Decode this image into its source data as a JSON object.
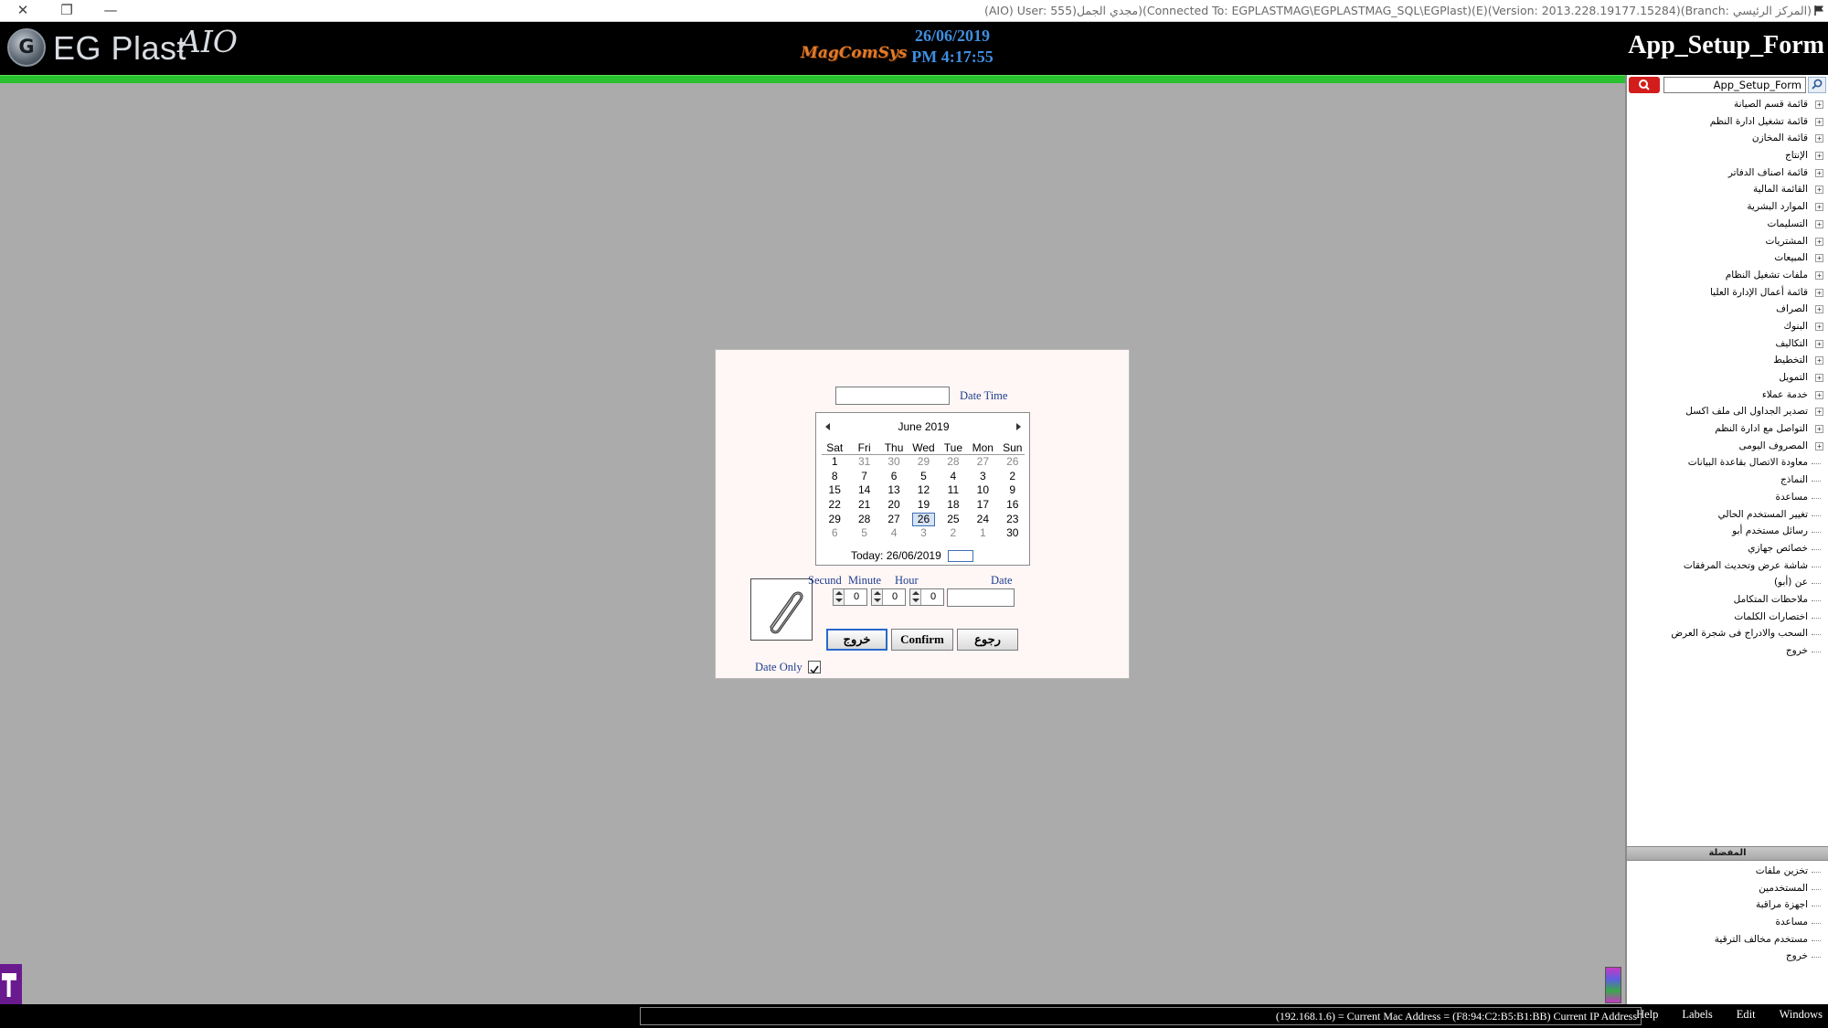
{
  "titlebar": {
    "title": "(AIO) User: 555)مجدي الجمل)(Connected To: EGPLASTMAG\\EGPLASTMAG_SQL\\EGPlast)(E)(Version: 2013.228.19177.15284)(Branch: المركز الرئيسي)",
    "close_glyph": "✕",
    "restore_glyph": "❐",
    "minimize_glyph": "—"
  },
  "header": {
    "logo_mark": "G",
    "logo_text": "EG Plast",
    "logo_script": "AIO",
    "brand": "MagComSys",
    "date": "26/06/2019",
    "time": "PM 4:17:55",
    "form_title": "App_Setup_Form"
  },
  "right_panel": {
    "search_value": "App_Setup_Form",
    "tree_items": [
      {
        "label": "قائمة قسم الصيانة",
        "expandable": true
      },
      {
        "label": "قائمة تشغيل ادارة النظم",
        "expandable": true
      },
      {
        "label": "قائمة المخازن",
        "expandable": true
      },
      {
        "label": "الإنتاج",
        "expandable": true
      },
      {
        "label": "قائمة اصناف الدفاتر",
        "expandable": true
      },
      {
        "label": "القائمة المالية",
        "expandable": true
      },
      {
        "label": "الموارد البشرية",
        "expandable": true
      },
      {
        "label": "التسليمات",
        "expandable": true
      },
      {
        "label": "المشتريات",
        "expandable": true
      },
      {
        "label": "المبيعات",
        "expandable": true
      },
      {
        "label": "ملفات تشغيل النظام",
        "expandable": true
      },
      {
        "label": "قائمة أعمال الإدارة العليا",
        "expandable": true
      },
      {
        "label": "الصراف",
        "expandable": true
      },
      {
        "label": "البنوك",
        "expandable": true
      },
      {
        "label": "التكاليف",
        "expandable": true
      },
      {
        "label": "التخطيط",
        "expandable": true
      },
      {
        "label": "التمويل",
        "expandable": true
      },
      {
        "label": "خدمة عملاء",
        "expandable": true
      },
      {
        "label": "تصدير الجداول الى ملف اكسل",
        "expandable": true
      },
      {
        "label": "التواصل مع ادارة النظم",
        "expandable": true
      },
      {
        "label": "المصروف اليومى",
        "expandable": true
      },
      {
        "label": "معاودة الاتصال بقاعدة البيانات",
        "expandable": false
      },
      {
        "label": "النماذج",
        "expandable": false
      },
      {
        "label": "مساعدة",
        "expandable": false
      },
      {
        "label": "تغيير المستخدم الحالي",
        "expandable": false
      },
      {
        "label": "رسائل مستخدم أبو",
        "expandable": false
      },
      {
        "label": "خصائص جهازي",
        "expandable": false
      },
      {
        "label": "شاشة عرض وتحديث المرفقات",
        "expandable": false
      },
      {
        "label": "عن (أبو)",
        "expandable": false
      },
      {
        "label": "ملاحظات المتكامل",
        "expandable": false
      },
      {
        "label": "اختصارات الكلمات",
        "expandable": false
      },
      {
        "label": "السحب والادراج فى شجرة العرض",
        "expandable": false
      },
      {
        "label": "خروج",
        "expandable": false
      }
    ],
    "favorites_header": "المفضلة",
    "favorites": [
      {
        "label": "تخزين ملفات"
      },
      {
        "label": "المستخدمين"
      },
      {
        "label": "اجهزة مراقبة"
      },
      {
        "label": "مساعدة"
      },
      {
        "label": "مستخدم مخالف الترقية"
      },
      {
        "label": "خروج"
      }
    ]
  },
  "dialog": {
    "datetime_label": "Date Time",
    "datetime_value": "",
    "calendar": {
      "month_label": "June 2019",
      "day_headers": [
        "Sat",
        "Fri",
        "Thu",
        "Wed",
        "Tue",
        "Mon",
        "Sun"
      ],
      "weeks": [
        [
          "1",
          "31",
          "30",
          "29",
          "28",
          "27",
          "26"
        ],
        [
          "8",
          "7",
          "6",
          "5",
          "4",
          "3",
          "2"
        ],
        [
          "15",
          "14",
          "13",
          "12",
          "11",
          "10",
          "9"
        ],
        [
          "22",
          "21",
          "20",
          "19",
          "18",
          "17",
          "16"
        ],
        [
          "29",
          "28",
          "27",
          "26",
          "25",
          "24",
          "23"
        ],
        [
          "6",
          "5",
          "4",
          "3",
          "2",
          "1",
          "30"
        ]
      ],
      "today_label": "Today: 26/06/2019",
      "selected_day": "26"
    },
    "time_labels": {
      "second": "Secund",
      "minute": "Minute",
      "hour": "Hour",
      "date": "Date"
    },
    "second_value": "0",
    "minute_value": "0",
    "hour_value": "0",
    "date_value": "",
    "buttons": {
      "exit": "خروج",
      "confirm": "Confirm",
      "back": "رجوع"
    },
    "date_only_label": "Date Only",
    "date_only_checked": true
  },
  "statusbar": {
    "ip_text": "(192.168.1.6) = Current Mac Address = (F8:94:C2:B5:B1:BB) Current IP Address",
    "menu": [
      "Windows",
      "Edit",
      "Labels",
      "Help"
    ]
  },
  "colors": {
    "header_bg": "#000000",
    "accent_green": "#29c12f",
    "date_blue": "#3f8ee0",
    "label_blue": "#1e3e8e",
    "dialog_bg": "#fff6f6",
    "workspace_gray": "#ababab",
    "search_red": "#d31c1c"
  },
  "icons": {
    "window_close": "close-icon",
    "window_restore": "restore-icon",
    "window_minimize": "minimize-icon",
    "search": "search-icon",
    "attachment": "paperclip-icon",
    "calendar_prev": "chevron-left-icon",
    "calendar_next": "chevron-right-icon"
  }
}
